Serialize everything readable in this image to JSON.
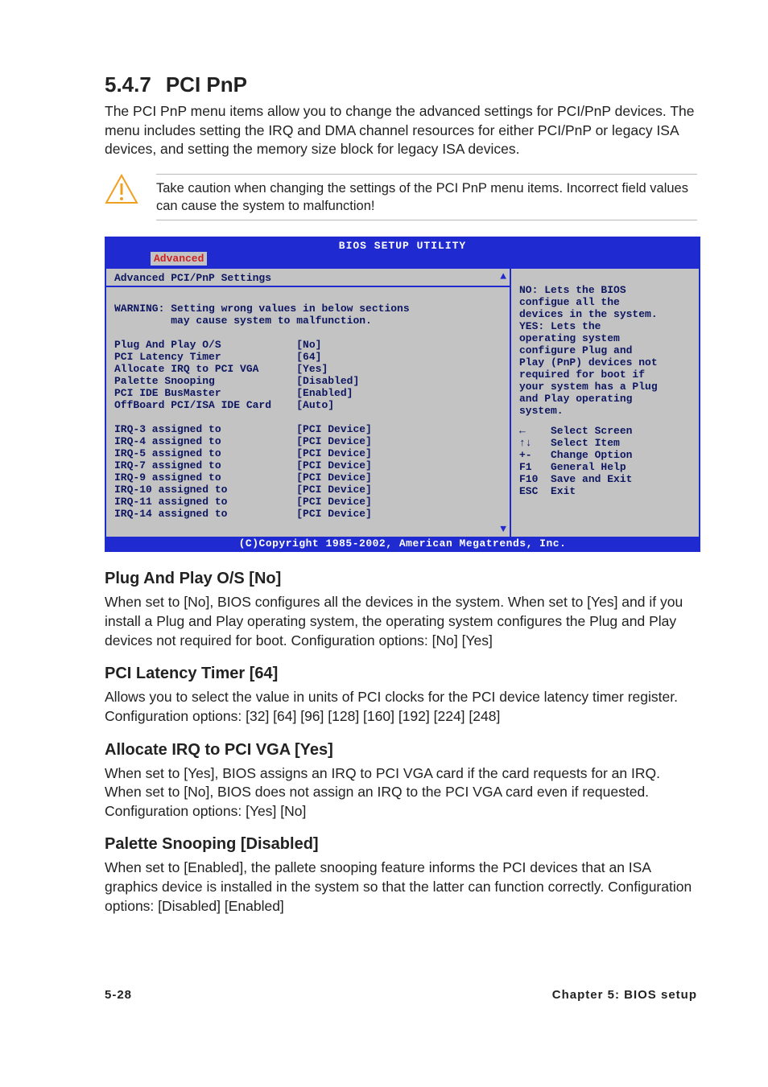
{
  "section": {
    "number": "5.4.7",
    "title": "PCI PnP",
    "intro": "The PCI PnP menu items allow you to change the advanced settings for PCI/PnP devices. The menu includes setting the IRQ and DMA channel resources for either PCI/PnP or legacy ISA devices, and setting the memory size block for legacy ISA devices."
  },
  "callout": {
    "text": "Take caution when changing the settings of the PCI PnP menu items. Incorrect field values can cause the system to malfunction!"
  },
  "bios": {
    "header": "BIOS SETUP UTILITY",
    "tab": "Advanced",
    "left_title": "Advanced PCI/PnP Settings",
    "warning": "WARNING: Setting wrong values in below sections\n         may cause system to malfunction.",
    "settings_block": "Plug And Play O/S            [No]\nPCI Latency Timer            [64]\nAllocate IRQ to PCI VGA      [Yes]\nPalette Snooping             [Disabled]\nPCI IDE BusMaster            [Enabled]\nOffBoard PCI/ISA IDE Card    [Auto]",
    "irq_block": "IRQ-3 assigned to            [PCI Device]\nIRQ-4 assigned to            [PCI Device]\nIRQ-5 assigned to            [PCI Device]\nIRQ-7 assigned to            [PCI Device]\nIRQ-9 assigned to            [PCI Device]\nIRQ-10 assigned to           [PCI Device]\nIRQ-11 assigned to           [PCI Device]\nIRQ-14 assigned to           [PCI Device]",
    "help_text": "NO: Lets the BIOS\nconfigue all the\ndevices in the system.\nYES: Lets the\noperating system\nconfigure Plug and\nPlay (PnP) devices not\nrequired for boot if\nyour system has a Plug\nand Play operating\nsystem.",
    "keynav": "←    Select Screen\n↑↓   Select Item\n+-   Change Option\nF1   General Help\nF10  Save and Exit\nESC  Exit",
    "footer": "(C)Copyright 1985-2002, American Megatrends, Inc."
  },
  "settings": {
    "pnp_os": {
      "title": "Plug And Play O/S [No]",
      "body": "When set to [No], BIOS configures all the devices in the system. When set to [Yes] and if you install a Plug and Play operating system, the operating system configures the Plug and Play devices not required for boot. Configuration options: [No] [Yes]"
    },
    "latency": {
      "title": "PCI Latency Timer [64]",
      "body": "Allows you to select the value in units of PCI clocks for the PCI device latency timer register. Configuration options: [32] [64] [96] [128] [160] [192] [224] [248]"
    },
    "irq_vga": {
      "title": "Allocate IRQ to PCI VGA [Yes]",
      "body": "When set to [Yes], BIOS assigns an IRQ to PCI VGA card if the card requests for an IRQ. When set to [No], BIOS does not assign an IRQ to the PCI VGA card even if requested. Configuration options: [Yes] [No]"
    },
    "palette": {
      "title": "Palette Snooping [Disabled]",
      "body": "When set to [Enabled], the pallete snooping feature informs the PCI devices that an ISA graphics device is installed in the system so that the latter can function correctly. Configuration options: [Disabled] [Enabled]"
    }
  },
  "footer": {
    "page": "5-28",
    "chapter": "Chapter 5: BIOS setup"
  }
}
